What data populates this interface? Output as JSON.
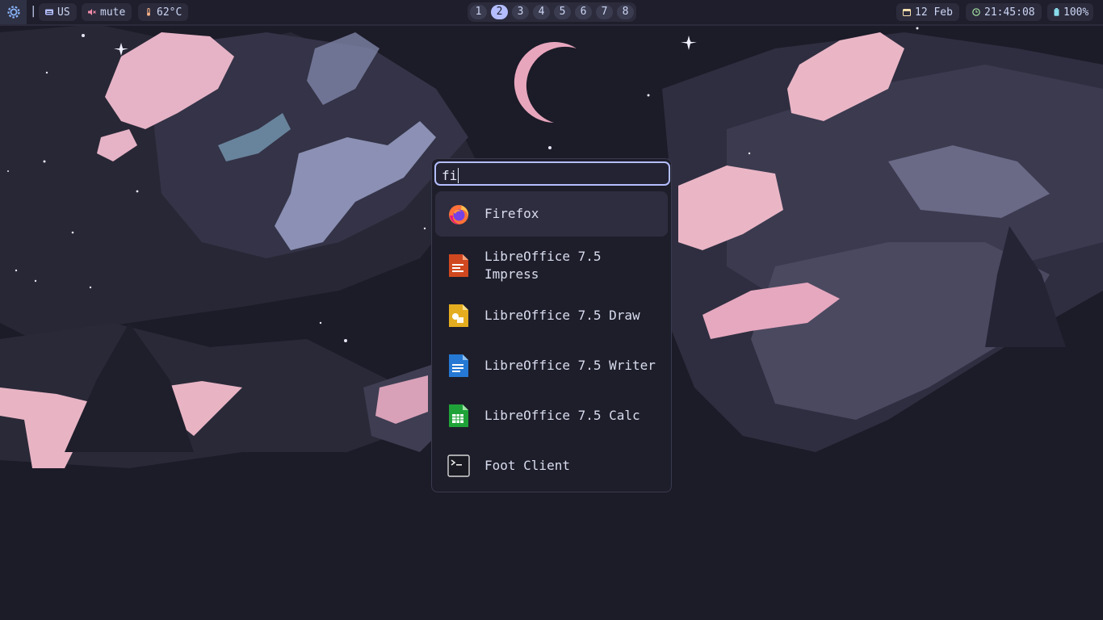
{
  "topbar": {
    "keyboard_layout": "US",
    "volume": "mute",
    "temperature": "62°C",
    "separator": "|",
    "workspaces": [
      "1",
      "2",
      "3",
      "4",
      "5",
      "6",
      "7",
      "8"
    ],
    "active_workspace": "2",
    "date": "12 Feb",
    "time": "21:45:08",
    "battery": "100%"
  },
  "launcher": {
    "query": "fi",
    "items": [
      {
        "label": "Firefox",
        "icon": "firefox-icon",
        "selected": true
      },
      {
        "label": "LibreOffice 7.5\nImpress",
        "icon": "libreoffice-impress-icon"
      },
      {
        "label": "LibreOffice 7.5 Draw",
        "icon": "libreoffice-draw-icon"
      },
      {
        "label": "LibreOffice 7.5 Writer",
        "icon": "libreoffice-writer-icon"
      },
      {
        "label": "LibreOffice 7.5 Calc",
        "icon": "libreoffice-calc-icon"
      },
      {
        "label": "Foot Client",
        "icon": "terminal-icon"
      }
    ]
  },
  "colors": {
    "accent": "#b4befe",
    "bar_bg": "#1e1e2c",
    "pill_bg": "#2b2b3c",
    "wallpaper_pink": "#e8b4c4",
    "wallpaper_lavender": "#9aa0c4"
  }
}
